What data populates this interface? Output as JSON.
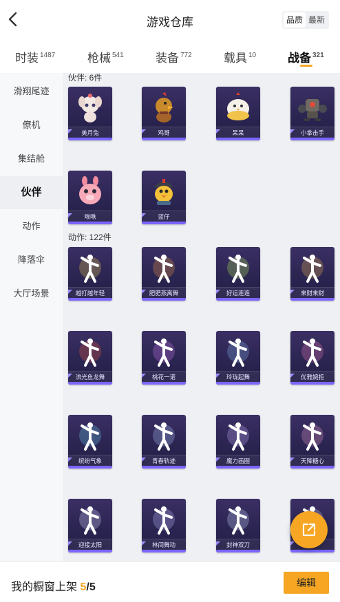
{
  "header": {
    "title": "游戏仓库",
    "back_icon": "chevron-left-icon",
    "sort": [
      "品质",
      "最新"
    ],
    "sort_active": 0
  },
  "tabs": [
    {
      "label": "时装",
      "count": "1487"
    },
    {
      "label": "枪械",
      "count": "541"
    },
    {
      "label": "装备",
      "count": "772"
    },
    {
      "label": "载具",
      "count": "10"
    },
    {
      "label": "战备",
      "count": "321"
    }
  ],
  "active_tab": 4,
  "sidebar": [
    "滑翔尾迹",
    "僚机",
    "集结舱",
    "伙伴",
    "动作",
    "降落伞",
    "大厅场景"
  ],
  "active_sidebar": 3,
  "sections": {
    "companion_title": "伙伴: 6件",
    "companions": [
      "美月兔",
      "鸡哥",
      "呆呆",
      "小拳击手",
      "啾啾",
      "蓝仔"
    ],
    "emote_title": "动作: 122件",
    "emotes": [
      "越打越年轻",
      "肥肥燕离舞",
      "好运连连",
      "来财来财",
      "流光鱼龙舞",
      "桃花一诺",
      "玲珑起舞",
      "优雅婉拒",
      "缤纷气象",
      "青春轨迹",
      "魔力画圈",
      "天降糖心",
      "迎接太阳",
      "林间舞动",
      "封神双刀",
      ""
    ]
  },
  "footer": {
    "label": "我的橱窗上架",
    "current": "5",
    "separator": "/",
    "total": "5",
    "edit_label": "编辑"
  },
  "fab_icon": "share-external-icon",
  "colors": {
    "accent": "#f6a623",
    "card_bg": "#2b2552",
    "card_stripe": "#7a66ff"
  }
}
